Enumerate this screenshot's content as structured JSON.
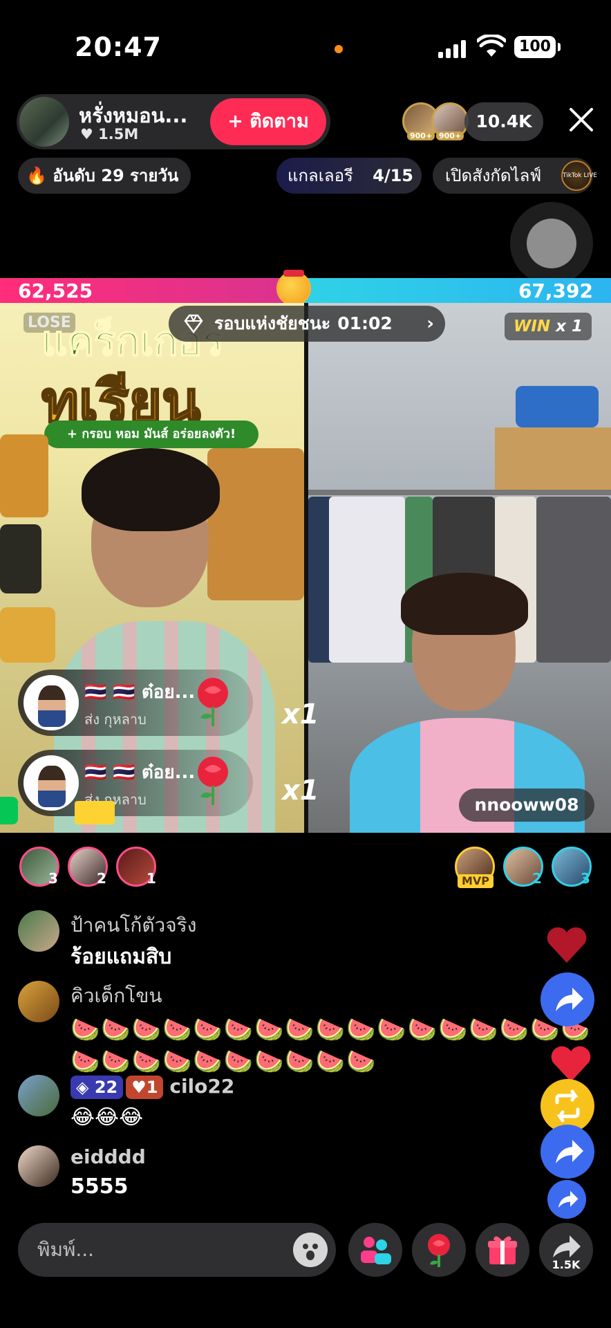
{
  "status_bar": {
    "time": "20:47",
    "battery": "100"
  },
  "host": {
    "name": "หรั่งหมอน...",
    "likes": "1.5M",
    "follow_label": "+ ติดตาม"
  },
  "viewers": {
    "count": "10.4K",
    "badge1": "900+",
    "badge2": "900+"
  },
  "ranking": {
    "label": "อันดับ 29 รายวัน"
  },
  "gallery": {
    "label": "แกลเลอรี",
    "count": "4/15"
  },
  "explore": {
    "label": "เปิดสังกัดไลฟ์",
    "badge_text": "TikTok LIVE"
  },
  "battle": {
    "left_score": "62,525",
    "right_score": "67,392",
    "left_fraction": 0.4813,
    "round_label": "รอบแห่งชัยชนะ",
    "round_time": "01:02",
    "left_result": "LOSE",
    "right_result_word": "WIN",
    "right_result_mult": "x 1",
    "colors": {
      "left": "#ff2d7a",
      "right": "#2fd3e6"
    }
  },
  "left_video": {
    "poster_title": "แคร็กเกอร์",
    "poster_title2": "ทุเรียน",
    "poster_tag": "+ กรอบ หอม มันส์ อร่อยลงตัว!"
  },
  "right_video": {
    "username": "nnooww08"
  },
  "gifts": [
    {
      "name": "🇹🇭 🇹🇭 ต๋อย...",
      "action": "ส่ง กุหลาบ",
      "multiplier": "x1"
    },
    {
      "name": "🇹🇭 🇹🇭 ต๋อย...",
      "action": "ส่ง กุหลาบ",
      "multiplier": "x1"
    }
  ],
  "contributors_left": [
    "3",
    "2",
    "1"
  ],
  "contributors_right": {
    "mvp": "MVP",
    "second": "2",
    "third": "3"
  },
  "chat": [
    {
      "user": "ป้าคนโก้ตัวจริง",
      "message": "ร้อยแถมสิบ"
    },
    {
      "user": "คิวเด็กโขน",
      "message": "🍉🍉🍉🍉🍉🍉🍉🍉🍉🍉🍉🍉🍉🍉🍉🍉🍉🍉🍉🍉🍉🍉🍉🍉🍉🍉🍉"
    },
    {
      "user": "cilo22",
      "gem_level": "22",
      "heart_level": "1",
      "message": "😂😂😂"
    },
    {
      "user": "eidddd",
      "message": "5555"
    }
  ],
  "input": {
    "placeholder": "พิมพ์..."
  },
  "share": {
    "count": "1.5K"
  }
}
